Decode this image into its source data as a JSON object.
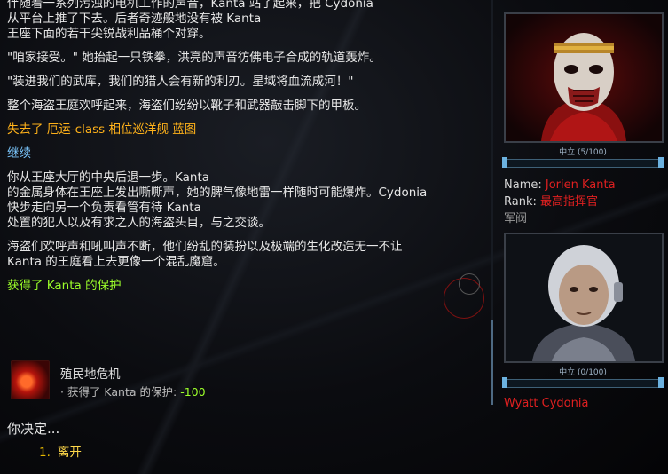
{
  "story": {
    "p0_line1": "伴随着一系列污浊的电机工作的声音，Kanta 站了起来，把 Cydonia",
    "p0_line2": "从平台上推了下去。后者奇迹般地没有被 Kanta",
    "p0_line3": "王座下面的若干尖锐战利品桶个对穿。",
    "p1": "\"咱家接受。\" 她抬起一只铁拳，洪亮的声音彷佛电子合成的轨道轰炸。",
    "p2": "\"装进我们的武库，我们的猎人会有新的利刃。星域将血流成河！\"",
    "p3": "整个海盗王庭欢呼起来，海盗们纷纷以靴子和武器敲击脚下的甲板。",
    "lost": "失去了 厄运-class 相位巡洋舰 蓝图",
    "continue": "继续",
    "p4_line1": "你从王座大厅的中央后退一步。Kanta",
    "p4_line2": "的金属身体在王座上发出嘶嘶声，她的脾气像地雷一样随时可能爆炸。Cydonia",
    "p4_line3": "快步走向另一个负责看管有待 Kanta",
    "p4_line4": "处置的犯人以及有求之人的海盗头目，与之交谈。",
    "p5_line1": "海盗们欢呼声和吼叫声不断，他们纷乱的装扮以及极端的生化改造无一不让",
    "p5_line2": "Kanta 的王庭看上去更像一个混乱魔窟。",
    "gained": "获得了 Kanta 的保护"
  },
  "effect": {
    "title": "殖民地危机",
    "desc_prefix": "· 获得了 Kanta 的保护:",
    "desc_value": "-100"
  },
  "decision": {
    "heading": "你决定...",
    "options": [
      {
        "number": "1.",
        "label": "离开"
      }
    ]
  },
  "character1": {
    "rep_label": "中立 (5/100)",
    "rep_fraction": 0.05,
    "name_key": "Name:",
    "name": "Jorien Kanta",
    "rank_key": "Rank:",
    "rank": "最高指挥官",
    "post": "军阀"
  },
  "character2": {
    "rep_label": "中立 (0/100)",
    "rep_fraction": 0.0,
    "name": "Wyatt Cydonia"
  },
  "colors": {
    "hostile_red": "#e02020",
    "lost_orange": "#ffb21a",
    "continue_blue": "#7cc8ff",
    "gain_green": "#9cff2a",
    "option_yellow": "#ffd84a"
  }
}
